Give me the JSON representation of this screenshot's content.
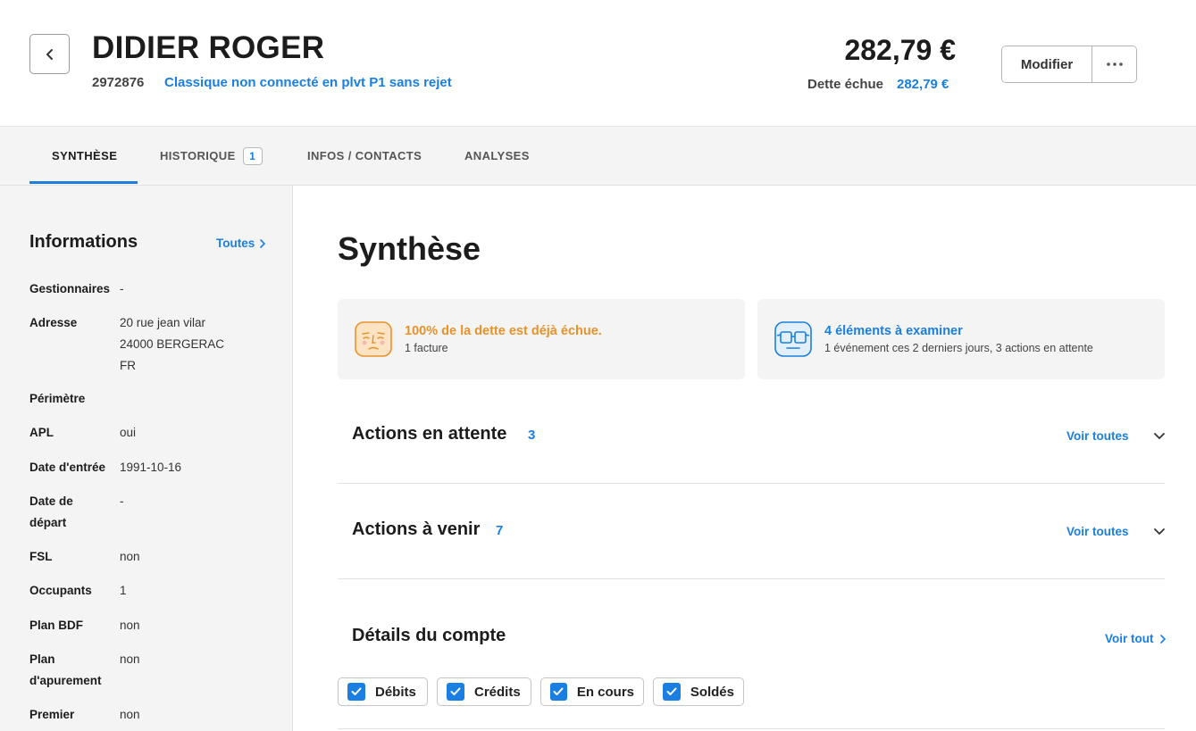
{
  "header": {
    "client_name": "DIDIER ROGER",
    "client_id": "2972876",
    "client_profile": "Classique non connecté en plvt P1 sans rejet",
    "total_amount": "282,79 €",
    "debt_label": "Dette échue",
    "debt_value": "282,79 €",
    "modify_label": "Modifier"
  },
  "tabs": [
    {
      "label": "SYNTHÈSE",
      "active": true
    },
    {
      "label": "HISTORIQUE",
      "badge": "1"
    },
    {
      "label": "INFOS / CONTACTS"
    },
    {
      "label": "ANALYSES"
    }
  ],
  "sidebar": {
    "title": "Informations",
    "link": "Toutes",
    "items": [
      {
        "label": "Gestionnaires",
        "value": "-"
      },
      {
        "label": "Adresse",
        "value_lines": [
          "20 rue jean vilar",
          "24000 BERGERAC",
          "FR"
        ]
      },
      {
        "label": "Périmètre",
        "value": ""
      },
      {
        "label": "APL",
        "value": "oui"
      },
      {
        "label": "Date d'entrée",
        "value": "1991-10-16"
      },
      {
        "label_lines": [
          "Date de",
          "départ"
        ],
        "value": "-"
      },
      {
        "label": "FSL",
        "value": "non"
      },
      {
        "label": "Occupants",
        "value": "1"
      },
      {
        "label": "Plan BDF",
        "value": "non"
      },
      {
        "label_lines": [
          "Plan",
          "d'apurement"
        ],
        "value": "non"
      },
      {
        "label": "Premier",
        "value": "non"
      }
    ]
  },
  "main": {
    "title": "Synthèse",
    "cards": [
      {
        "title": "100% de la dette est déjà échue.",
        "subtitle": "1 facture",
        "color": "#e9922a",
        "icon": "worried-face-icon"
      },
      {
        "title": "4 éléments à examiner",
        "subtitle": "1 événement ces 2 derniers jours, 3 actions en attente",
        "color": "#1a7fe0",
        "icon": "glasses-icon"
      }
    ],
    "sections": [
      {
        "title": "Actions en attente",
        "count": "3",
        "link": "Voir toutes"
      },
      {
        "title": "Actions à venir",
        "count": "7",
        "link": "Voir toutes"
      }
    ],
    "account": {
      "title": "Détails du compte",
      "link": "Voir tout",
      "filters": [
        "Débits",
        "Crédits",
        "En cours",
        "Soldés"
      ]
    }
  },
  "colors": {
    "accent": "#1a7fe0",
    "warning": "#e9922a",
    "panel": "#f4f4f4"
  }
}
